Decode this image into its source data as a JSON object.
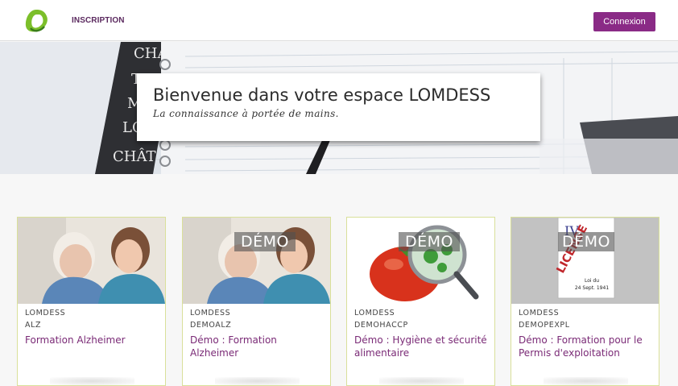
{
  "header": {
    "logo_icon": "lomdess-logo-icon",
    "nav_inscription": "INSCRIPTION",
    "login_button": "Connexion",
    "accent_color": "#8a2b86"
  },
  "banner": {
    "title": "Bienvenue dans votre espace LOMDESS",
    "subtitle": "La connaissance à portée de mains."
  },
  "cards": [
    {
      "org": "LOMDESS",
      "code": "ALZ",
      "title": "Formation Alzheimer",
      "badge": "",
      "image_icon": "caregiver-elderly-photo"
    },
    {
      "org": "LOMDESS",
      "code": "DEMOALZ",
      "title": "Démo : Formation Alzheimer",
      "badge": "DÉMO",
      "image_icon": "caregiver-elderly-photo"
    },
    {
      "org": "LOMDESS",
      "code": "DEMOHACCP",
      "title": "Démo : Hygiène et sécurité alimentaire",
      "badge": "DÉMO",
      "image_icon": "tomato-magnifier-illustration"
    },
    {
      "org": "LOMDESS",
      "code": "DEMOPEXPL",
      "title": "Démo : Formation pour le Permis d'exploitation",
      "badge": "DÉMO",
      "image_icon": "license-iv-illustration"
    }
  ],
  "license_image_text": {
    "numeral": "IV",
    "word": "LICENSE",
    "law": "Loi du",
    "date": "24 Sept. 1941"
  }
}
